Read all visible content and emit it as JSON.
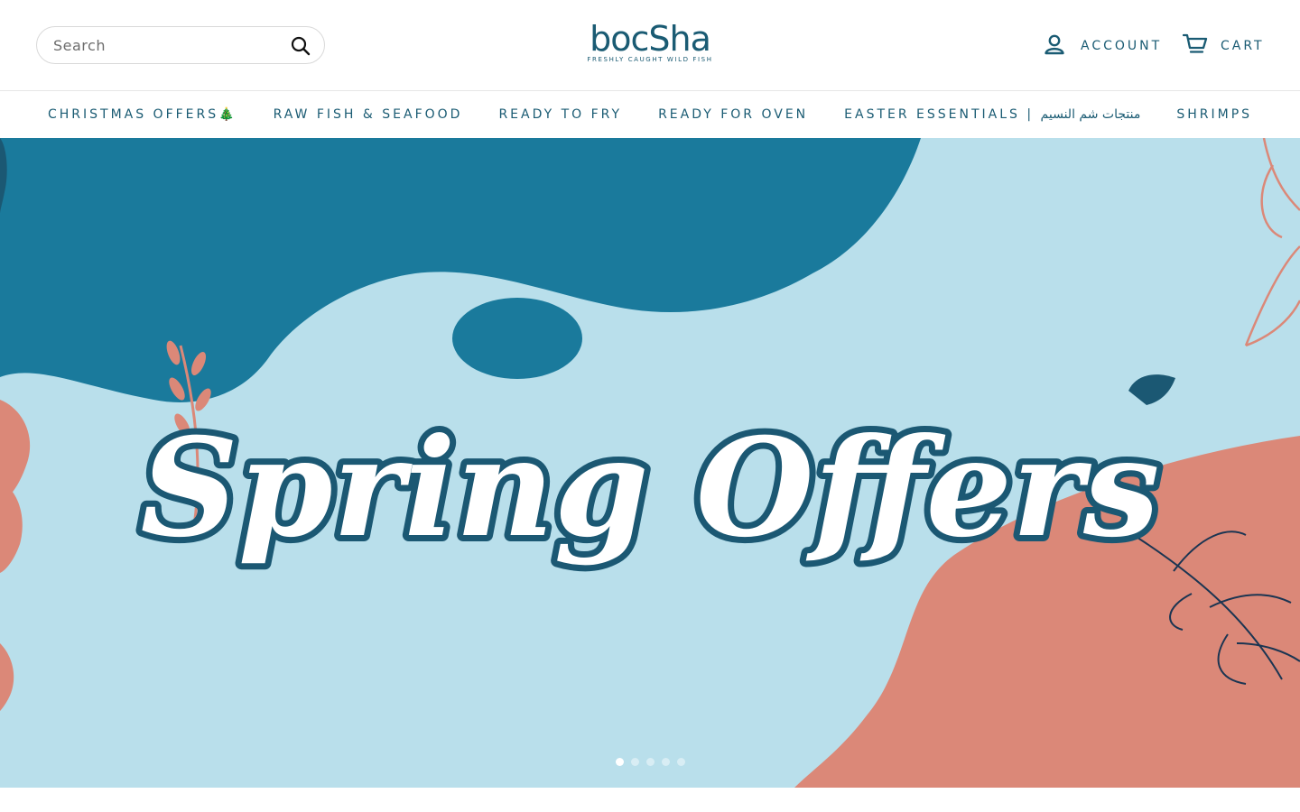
{
  "search": {
    "placeholder": "Search"
  },
  "brand": {
    "name": "bocSha",
    "tagline": "FRESHLY CAUGHT WILD FISH"
  },
  "header": {
    "account_label": "ACCOUNT",
    "cart_label": "CART"
  },
  "nav": {
    "items": [
      {
        "label": "CHRISTMAS OFFERS🎄"
      },
      {
        "label": "RAW FISH & SEAFOOD"
      },
      {
        "label": "READY TO FRY"
      },
      {
        "label": "READY FOR OVEN"
      },
      {
        "label": "EASTER ESSENTIALS | منتجات شم النسيم"
      },
      {
        "label": "SHRIMPS"
      }
    ]
  },
  "hero": {
    "headline": "Spring Offers",
    "slides_total": 5,
    "active_slide": 1,
    "colors": {
      "dark_teal": "#1a7a9c",
      "light_blue": "#b9dfeb",
      "coral": "#db8878",
      "outline": "#1b5873"
    }
  }
}
